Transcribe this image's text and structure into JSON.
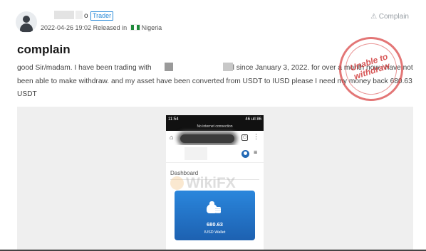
{
  "header": {
    "name_suffix": "o",
    "badge": "Trader",
    "date": "2022-04-26 19:02",
    "released_in_label": "Released in",
    "country": "Nigeria",
    "complain_link": "Complain",
    "warn_icon": "warning-triangle-icon"
  },
  "post": {
    "title": "complain",
    "body_part1": "good Sir/madam. I have been trading with",
    "body_part2": "l since January 3, 2022. for over a month now i have not been able to make withdraw. and my asset have been converted from USDT to IUSD please I need my money back 680.63 USDT",
    "stamp_text_line1": "Unable to",
    "stamp_text_line2": "withdraw"
  },
  "screenshot": {
    "status_time": "11:54",
    "status_right": "46 ull 86",
    "no_internet": "No internet connection",
    "dashboard_label": "Dashboard",
    "watermark": "WikiFX",
    "wallet_amount": "680.63",
    "wallet_label": "IUSD Wallet"
  },
  "colors": {
    "badge_blue": "#2b8bd8",
    "card_blue": "#1d61b1",
    "stamp_red": "#d73c3c"
  }
}
